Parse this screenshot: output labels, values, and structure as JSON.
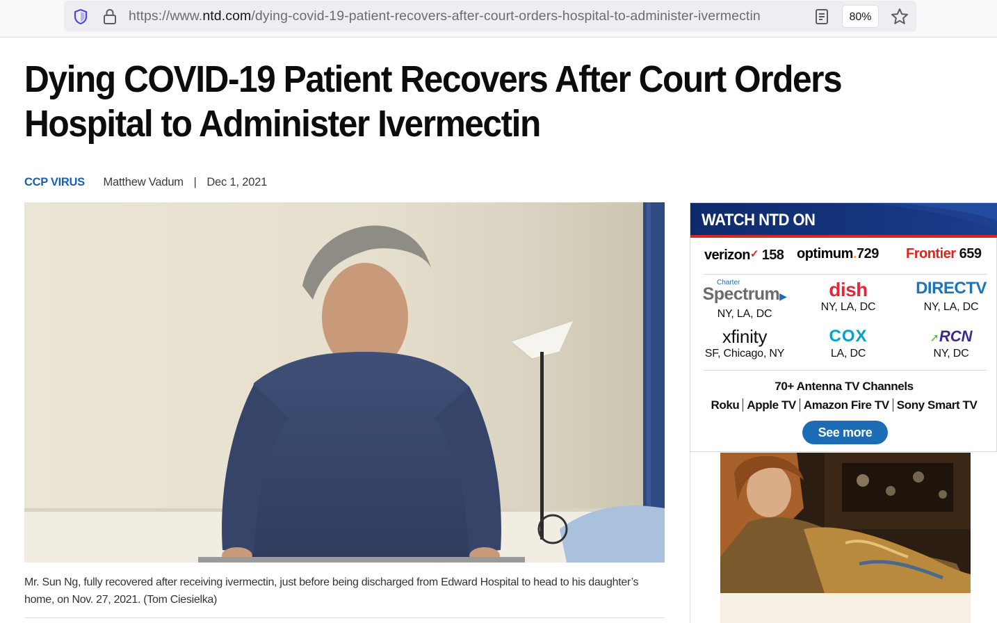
{
  "browser": {
    "url_prefix": "https://www.",
    "url_host": "ntd.com",
    "url_path": "/dying-covid-19-patient-recovers-after-court-orders-hospital-to-administer-ivermectin",
    "zoom": "80%"
  },
  "article": {
    "headline": "Dying COVID-19 Patient Recovers After Court Orders Hospital to Administer Ivermectin",
    "category": "CCP VIRUS",
    "author": "Matthew Vadum",
    "separator": "|",
    "date": "Dec 1, 2021",
    "caption": "Mr. Sun Ng, fully recovered after receiving ivermectin, just before being discharged from Edward Hospital to head to his daughter’s home, on Nov. 27, 2021. (Tom Ciesielka)"
  },
  "sidebar": {
    "title": "WATCH NTD ON",
    "top_providers": [
      {
        "name": "verizon",
        "tick": "✓",
        "channel": "158"
      },
      {
        "name": "optimum",
        "dot": ".",
        "channel": "729"
      },
      {
        "name": "Frontier",
        "channel": "659"
      }
    ],
    "providers": [
      {
        "name": "Spectrum",
        "sub": "Charter",
        "locations": "NY, LA, DC"
      },
      {
        "name": "dish",
        "locations": "NY, LA, DC"
      },
      {
        "name": "DIRECTV",
        "locations": "NY, LA, DC"
      },
      {
        "name": "xfinity",
        "locations": "SF, Chicago, NY"
      },
      {
        "name": "COX",
        "locations": "LA, DC"
      },
      {
        "name": "RCN",
        "locations": "NY, DC"
      }
    ],
    "antenna": "70+ Antenna TV Channels",
    "devices": [
      "Roku",
      "Apple TV",
      "Amazon Fire TV",
      "Sony Smart TV"
    ],
    "see_more": "See more"
  },
  "colors": {
    "category_blue": "#1b5fb0",
    "ntd_header": "#15357e",
    "ntd_red": "#d8262d",
    "see_more": "#1b6cb5"
  }
}
